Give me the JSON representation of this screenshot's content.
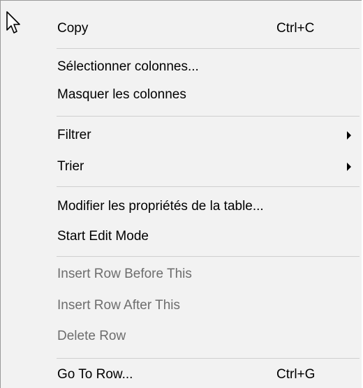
{
  "menu": {
    "copy": {
      "label": "Copy",
      "shortcut": "Ctrl+C"
    },
    "select_columns": {
      "label": "Sélectionner colonnes..."
    },
    "hide_columns": {
      "label": "Masquer les colonnes"
    },
    "filter": {
      "label": "Filtrer"
    },
    "sort": {
      "label": "Trier"
    },
    "table_properties": {
      "label": "Modifier les propriétés de la table..."
    },
    "start_edit": {
      "label": "Start Edit Mode"
    },
    "insert_before": {
      "label": "Insert Row Before This"
    },
    "insert_after": {
      "label": "Insert Row After This"
    },
    "delete_row": {
      "label": "Delete Row"
    },
    "go_to_row": {
      "label": "Go To Row...",
      "shortcut": "Ctrl+G"
    }
  },
  "icons": {
    "cursor": "mouse-pointer-icon",
    "submenu_arrow": "chevron-right-icon"
  },
  "colors": {
    "menu_background": "#f2f2f2",
    "disabled_text": "#6d6d6d",
    "separator": "#cfcfcf"
  }
}
